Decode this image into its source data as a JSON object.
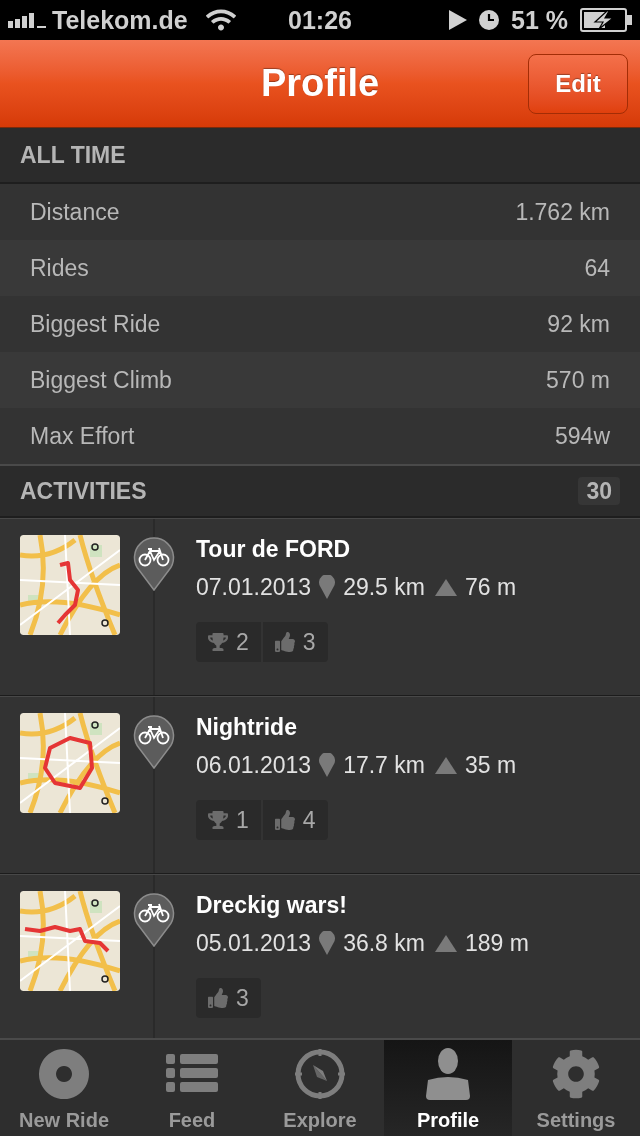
{
  "status_bar": {
    "carrier": "Telekom.de",
    "time": "01:26",
    "battery": "51 %"
  },
  "nav_bar": {
    "title": "Profile",
    "edit_button": "Edit"
  },
  "all_time": {
    "header": "ALL TIME",
    "stats": [
      {
        "label": "Distance",
        "value": "1.762 km"
      },
      {
        "label": "Rides",
        "value": "64"
      },
      {
        "label": "Biggest Ride",
        "value": "92 km"
      },
      {
        "label": "Biggest Climb",
        "value": "570 m"
      },
      {
        "label": "Max Effort",
        "value": "594w"
      }
    ]
  },
  "activities": {
    "header": "ACTIVITIES",
    "count": "30",
    "items": [
      {
        "title": "Tour de FORD",
        "date": "07.01.2013",
        "distance": "29.5 km",
        "elevation": "76 m",
        "achievements": "2",
        "kudos": "3"
      },
      {
        "title": "Nightride",
        "date": "06.01.2013",
        "distance": "17.7 km",
        "elevation": "35 m",
        "achievements": "1",
        "kudos": "4"
      },
      {
        "title": "Dreckig wars!",
        "date": "05.01.2013",
        "distance": "36.8 km",
        "elevation": "189 m",
        "kudos": "3"
      }
    ]
  },
  "tab_bar": [
    {
      "label": "New Ride",
      "selected": false
    },
    {
      "label": "Feed",
      "selected": false
    },
    {
      "label": "Explore",
      "selected": false
    },
    {
      "label": "Profile",
      "selected": true
    },
    {
      "label": "Settings",
      "selected": false
    }
  ]
}
